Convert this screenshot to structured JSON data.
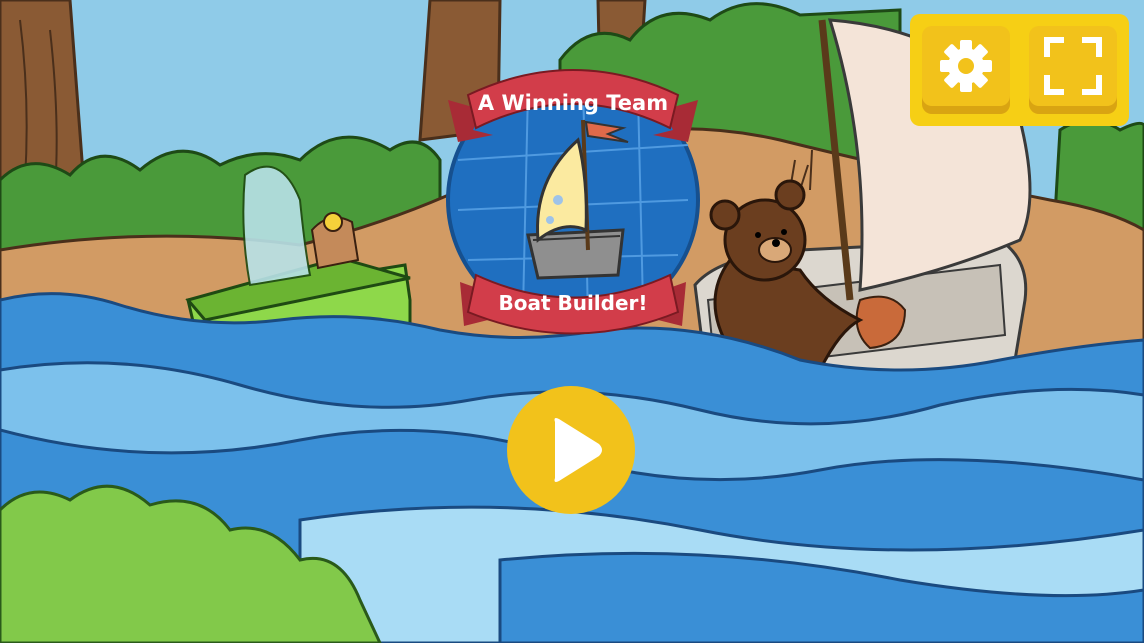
{
  "game": {
    "title_line1": "A Winning Team",
    "title_line2": "Boat Builder!"
  },
  "controls": {
    "settings_icon": "gear-icon",
    "fullscreen_icon": "fullscreen-icon",
    "play_icon": "play-icon"
  },
  "colors": {
    "toolbar_bg": "#f6cf15",
    "button_yellow": "#f2c21b",
    "banner_red": "#d23d4a",
    "river_blue": "#3a8fd6",
    "sky_blue": "#8fcbe8"
  }
}
